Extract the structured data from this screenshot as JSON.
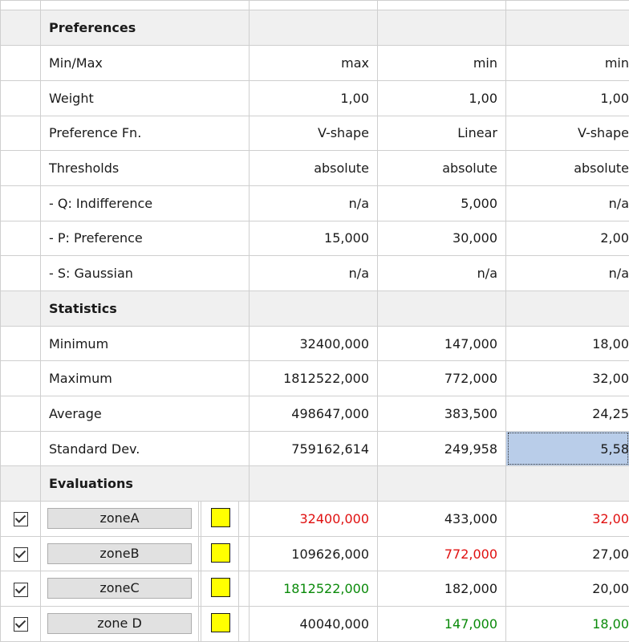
{
  "preferences": {
    "header": "Preferences",
    "rows": [
      {
        "label": "Min/Max",
        "v": [
          "max",
          "min",
          "min"
        ]
      },
      {
        "label": "Weight",
        "v": [
          "1,00",
          "1,00",
          "1,00"
        ]
      },
      {
        "label": "Preference Fn.",
        "v": [
          "V-shape",
          "Linear",
          "V-shape"
        ]
      },
      {
        "label": "Thresholds",
        "v": [
          "absolute",
          "absolute",
          "absolute"
        ]
      },
      {
        "label": "- Q: Indifference",
        "v": [
          "n/a",
          "5,000",
          "n/a"
        ]
      },
      {
        "label": "- P: Preference",
        "v": [
          "15,000",
          "30,000",
          "2,00"
        ]
      },
      {
        "label": "- S: Gaussian",
        "v": [
          "n/a",
          "n/a",
          "n/a"
        ]
      }
    ]
  },
  "statistics": {
    "header": "Statistics",
    "rows": [
      {
        "label": "Minimum",
        "v": [
          "32400,000",
          "147,000",
          "18,00"
        ]
      },
      {
        "label": "Maximum",
        "v": [
          "1812522,000",
          "772,000",
          "32,00"
        ]
      },
      {
        "label": "Average",
        "v": [
          "498647,000",
          "383,500",
          "24,25"
        ]
      },
      {
        "label": "Standard Dev.",
        "v": [
          "759162,614",
          "249,958",
          "5,58"
        ]
      }
    ]
  },
  "evaluations": {
    "header": "Evaluations",
    "rows": [
      {
        "name": "zoneA",
        "checked": true,
        "swatch": "#ffff00",
        "v": [
          "32400,000",
          "433,000",
          "32,00"
        ],
        "c": [
          "red",
          "",
          "red"
        ]
      },
      {
        "name": "zoneB",
        "checked": true,
        "swatch": "#ffff00",
        "v": [
          "109626,000",
          "772,000",
          "27,00"
        ],
        "c": [
          "",
          "red",
          ""
        ]
      },
      {
        "name": "zoneC",
        "checked": true,
        "swatch": "#ffff00",
        "v": [
          "1812522,000",
          "182,000",
          "20,00"
        ],
        "c": [
          "green",
          "",
          ""
        ]
      },
      {
        "name": "zone D",
        "checked": true,
        "swatch": "#ffff00",
        "v": [
          "40040,000",
          "147,000",
          "18,00"
        ],
        "c": [
          "",
          "green",
          "green"
        ]
      }
    ]
  },
  "colors": {
    "best": "#0a8a0a",
    "worst": "#e01010",
    "selection": "#b9cde9"
  }
}
